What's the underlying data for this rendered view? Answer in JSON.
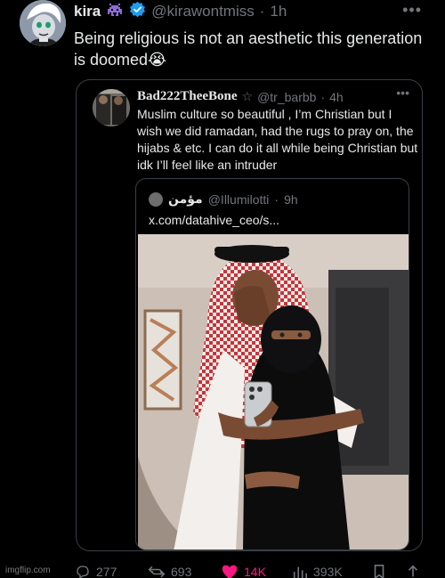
{
  "tweet": {
    "name": "kira",
    "handle": "@kirawontmiss",
    "separator": "·",
    "time": "1h",
    "more": "•••",
    "text": "Being religious is not an aesthetic this generation is doomed😭"
  },
  "quote": {
    "name": "Bad222TheeBone",
    "name_badge": "☆",
    "handle": "@tr_barbb",
    "separator": "·",
    "time": "4h",
    "more": "•••",
    "text": "Muslim culture so beautiful , I’m Christian but I wish we did ramadan, had the rugs to pray on, the hijabs & etc. I can do it all while being Christian but idk I’ll feel like an intruder"
  },
  "inner_quote": {
    "name": "مؤمن",
    "handle": "@Illumilotti",
    "separator": "·",
    "time": "9h",
    "link": "x.com/datahive_ceo/s..."
  },
  "actions": {
    "replies": "277",
    "reposts": "693",
    "likes": "14K",
    "views": "393K"
  },
  "watermark": "imgflip.com",
  "colors": {
    "background": "#000000",
    "text": "#e7e9ea",
    "secondary": "#71767b",
    "verified": "#1d9bf0",
    "like": "#f91880",
    "border": "#3a3f44"
  }
}
